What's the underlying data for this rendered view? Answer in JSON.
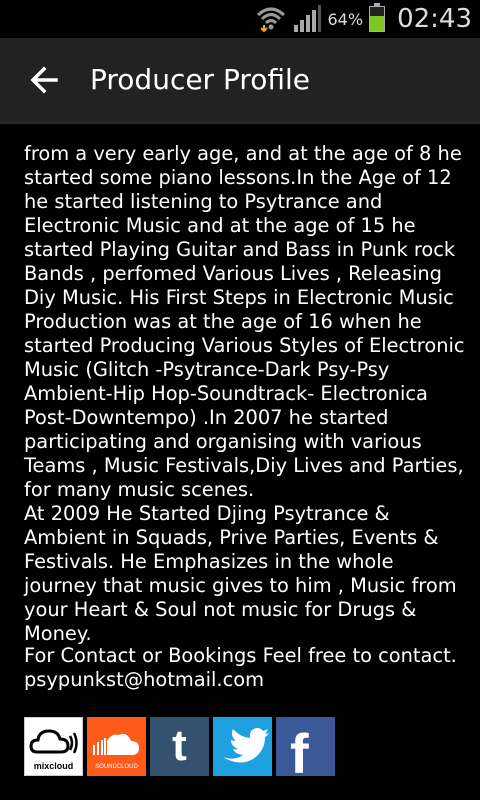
{
  "status_bar": {
    "battery_percent": "64%",
    "battery_level": 0.64,
    "time": "02:43",
    "icons": [
      "wifi-icon",
      "signal-icon",
      "battery-icon"
    ]
  },
  "action_bar": {
    "back_icon": "arrow-left-icon",
    "title": "Producer Profile"
  },
  "bio": {
    "text": "from a very early age, and at the age of 8 he started some piano lessons.In the Age of 12 he started listening to Psytrance and Electronic Music and at the age of 15 he started Playing Guitar and Bass in Punk rock Bands , perfomed Various Lives , Releasing Diy Music. His First Steps in Electronic Music Production was at the age of 16 when he started Producing Various Styles of Electronic Music (Glitch -Psytrance-Dark Psy-Psy Ambient-Hip Hop-Soundtrack- Electronica Post-Downtempo) .In 2007 he started participating and organising with various Teams , Music Festivals,Diy Lives and Parties, for many music scenes.\nAt 2009 He Started Djing Psytrance & Ambient in Squads, Prive Parties, Events & Festivals. He Emphasizes in the whole journey that music gives to him , Music from your Heart & Soul not music for Drugs & Money."
  },
  "contact": {
    "line": "For Contact or Bookings Feel free to contact.",
    "email": "psypunkst@hotmail.com"
  },
  "social": {
    "mixcloud_label": "mixcloud",
    "soundcloud_label": "SOUNDCLOUD",
    "tumblr_glyph": "t",
    "facebook_glyph": "f"
  },
  "colors": {
    "background": "#000000",
    "action_bar": "#222222",
    "text": "#ffffff",
    "battery_fill": "#7bc820",
    "soundcloud": "#ff5a1a",
    "tumblr": "#34526f",
    "twitter": "#1fa1e1",
    "facebook": "#3b5998"
  }
}
